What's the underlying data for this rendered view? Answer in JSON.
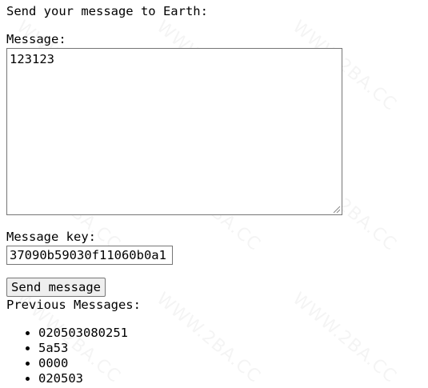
{
  "heading": "Send your message to Earth:",
  "message_label": "Message:",
  "message_value": "123123",
  "key_label": "Message key:",
  "key_value": "37090b59030f11060b0a1",
  "send_button": "Send message",
  "previous_label": "Previous Messages:",
  "previous_messages": [
    "020503080251",
    "5a53",
    "0000",
    "020503"
  ],
  "watermark_text": "WWW.2BA.CC"
}
